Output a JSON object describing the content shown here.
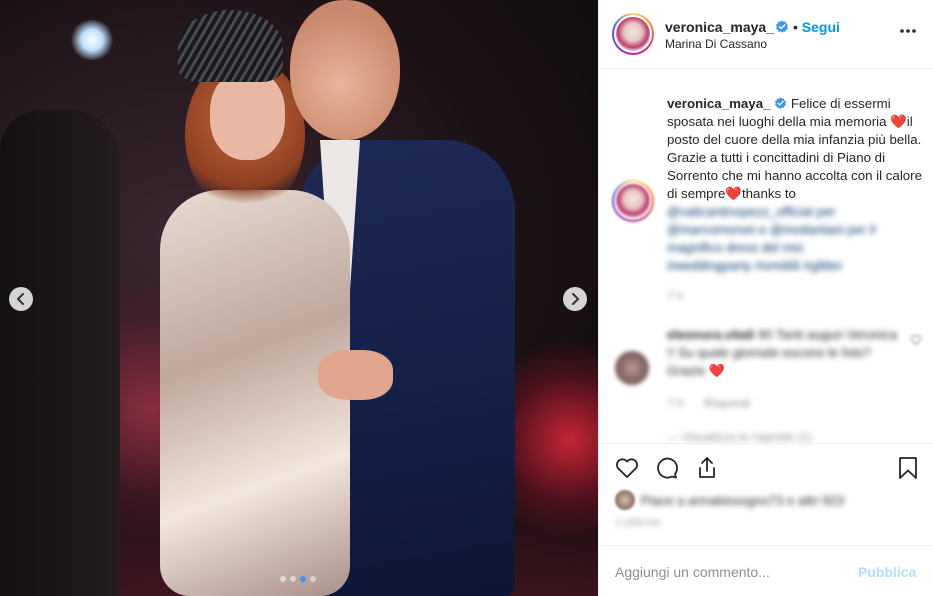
{
  "post": {
    "carousel": {
      "slide_count": 4,
      "active_slide": 3
    }
  },
  "header": {
    "username": "veronica_maya_",
    "separator": "•",
    "follow_label": "Segui",
    "location": "Marina Di Cassano"
  },
  "caption": {
    "username": "veronica_maya_",
    "text_part1": "Felice di essermi sposata nei luoghi della mia memoria",
    "heart1": "❤️",
    "text_part2": "il posto del cuore della mia infanzia più bella. Grazie a tutti i concittadini di Piano di Sorrento che mi hanno accolta con il calore di sempre",
    "heart2": "❤️",
    "text_part3": "thanks to",
    "tags_line1": "@valicantinopezz_official per",
    "tags_line2": "@marcomorsei e @modartiani per il",
    "tags_line3": "magnifico dress del mio",
    "tags_line4": "#weddingparty #smiiiiili #glitter",
    "time": "7 h"
  },
  "comment": {
    "username": "eleonora.vitali",
    "text": "90 Tanti auguri Veronica !! Su quale giornale escono le foto?Grazie",
    "heart": "❤️",
    "time": "7 h",
    "reply_label": "Rispondi",
    "view_replies": "— Visualizza le risposte (1)"
  },
  "likes": {
    "text": "Piace a annabissogno73 e altri 923"
  },
  "date": "1 ORA FA",
  "add_comment": {
    "placeholder": "Aggiungi un commento...",
    "publish_label": "Pubblica"
  },
  "colors": {
    "accent": "#0095f6",
    "publish_disabled": "#b2dffc",
    "heart": "#e6265a",
    "carousel_active_dot": "#3897f0"
  },
  "icons": {
    "verified": "verified-badge-icon",
    "more": "more-options-icon",
    "like": "heart-icon",
    "comment": "comment-bubble-icon",
    "share": "share-icon",
    "save": "bookmark-icon",
    "prev": "chevron-left-icon",
    "next": "chevron-right-icon"
  }
}
